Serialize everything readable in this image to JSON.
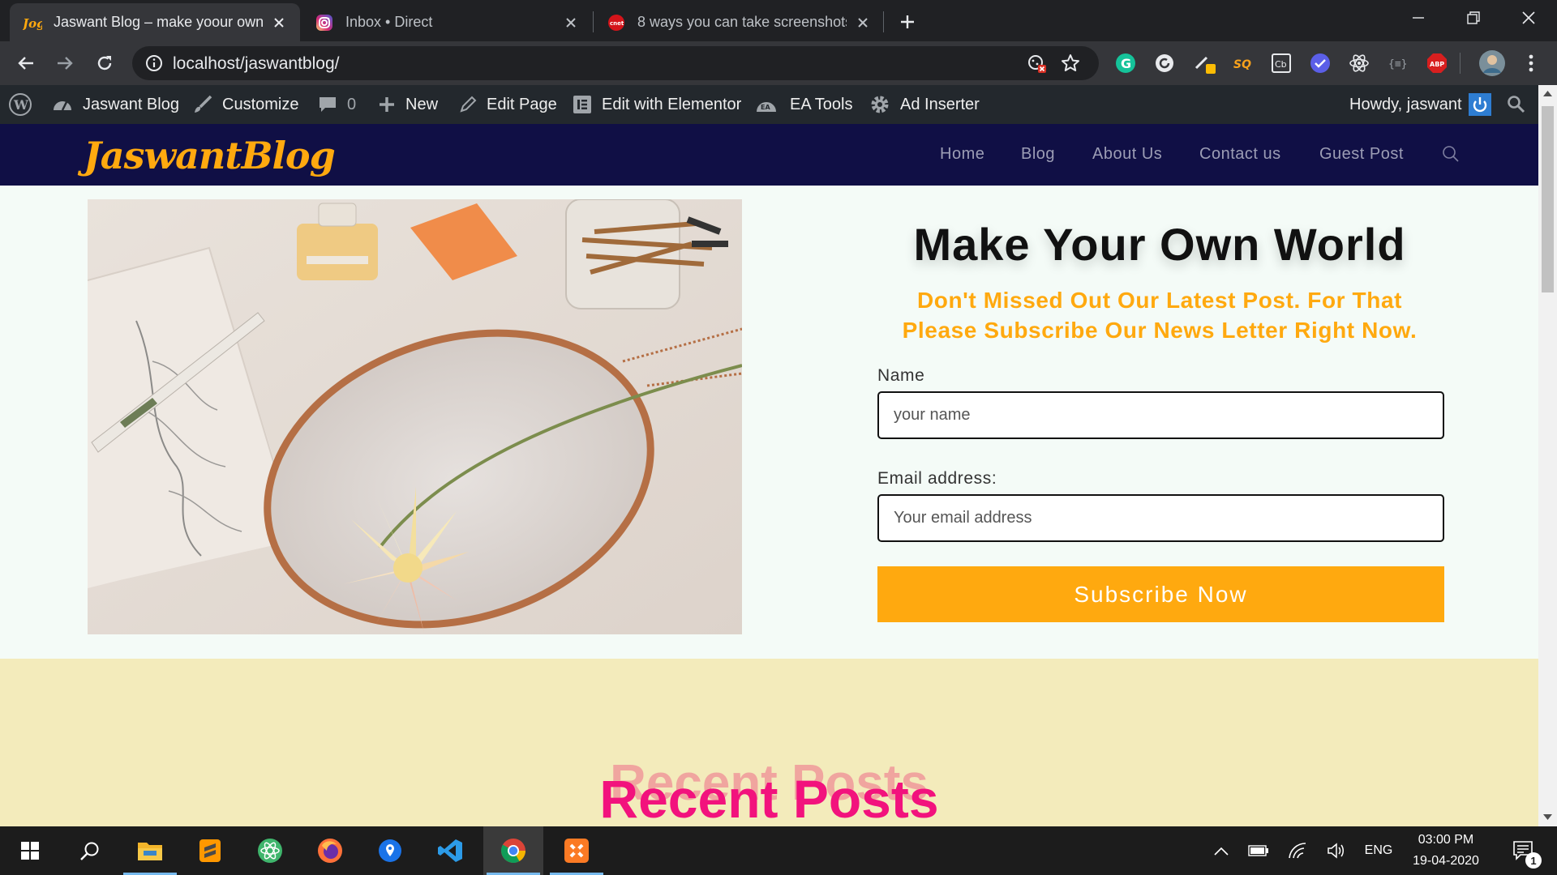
{
  "browser": {
    "tabs": [
      {
        "title": "Jaswant Blog – make yoour own w",
        "active": true
      },
      {
        "title": "Inbox • Direct",
        "active": false
      },
      {
        "title": "8 ways you can take screenshots",
        "active": false
      }
    ],
    "url": "localhost/jaswantblog/"
  },
  "admin_bar": {
    "site_name": "Jaswant Blog",
    "customize": "Customize",
    "comments_count": "0",
    "new": "New",
    "edit_page": "Edit Page",
    "edit_elementor": "Edit with Elementor",
    "ea_tools": "EA Tools",
    "ad_inserter": "Ad Inserter",
    "howdy": "Howdy, jaswant"
  },
  "site": {
    "logo": "JaswantBlog",
    "menu": [
      "Home",
      "Blog",
      "About Us",
      "Contact us",
      "Guest Post"
    ]
  },
  "hero": {
    "title": "Make Your Own World",
    "subtitle_line1": "Don't Missed Out Our Latest Post. For That",
    "subtitle_line2": "Please Subscribe Our News Letter Right Now.",
    "name_label": "Name",
    "name_placeholder": "your name",
    "email_label": "Email address:",
    "email_placeholder": "Your email address",
    "subscribe_label": "Subscribe Now"
  },
  "recent": {
    "title": "Recent Posts"
  },
  "taskbar": {
    "language": "ENG",
    "time": "03:00 PM",
    "date": "19-04-2020",
    "notification_count": "1"
  },
  "colors": {
    "accent": "#ffa90f",
    "header_bg": "#100f45",
    "recent_title": "#f2127d",
    "recent_bg": "#f3ebbb"
  }
}
